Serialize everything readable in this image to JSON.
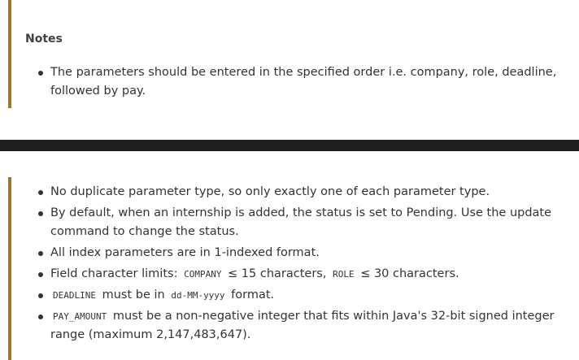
{
  "notes": {
    "title": "Notes",
    "items": [
      "The parameters should be entered in the specified order i.e. company, role, deadline, followed by pay."
    ]
  },
  "constraints": {
    "items": [
      {
        "text": "No duplicate parameter type, so only exactly one of each parameter type."
      },
      {
        "text": "By default, when an internship is added, the status is set to Pending. Use the update command to change the status."
      },
      {
        "text": "All index parameters are in 1-indexed format."
      },
      {
        "pre": "Field character limits:",
        "code1": "COMPANY",
        "mid": "≤ 15 characters,",
        "code2": "ROLE",
        "post": "≤ 30 characters."
      },
      {
        "code1": "DEADLINE",
        "mid": "must be in",
        "code2": "dd-MM-yyyy",
        "post": "format."
      },
      {
        "code1": "PAY_AMOUNT",
        "post": "must be a non-negative integer that fits within Java's 32-bit signed integer range (maximum 2,147,483,647)."
      }
    ]
  },
  "colors": {
    "accent": "#a0762b",
    "divider": "#1d1f20"
  }
}
